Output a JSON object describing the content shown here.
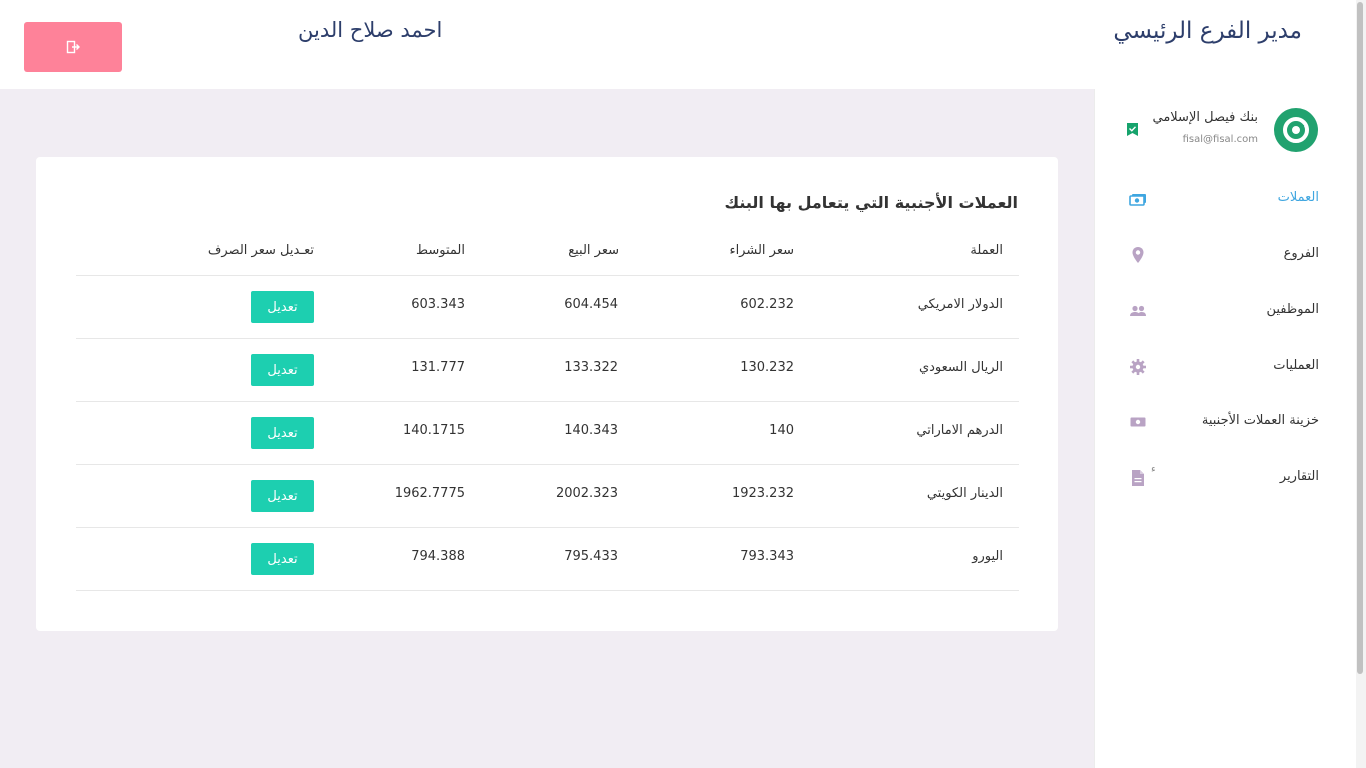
{
  "header": {
    "title": "مدير الفرع الرئيسي",
    "user_name": "احمد صلاح الدين",
    "logout_icon": "logout-icon"
  },
  "colors": {
    "logout_button": "#fe8299",
    "edit_button": "#1dcfb0",
    "active_nav": "#3fa6e0",
    "title_text": "#2d3e6b",
    "main_bg": "#f1edf3"
  },
  "sidebar": {
    "bank_name": "بنك فيصل الإسلامي",
    "bank_email": "fisal@fisal.com",
    "items": [
      {
        "label": "العملات",
        "icon": "money-icon",
        "active": true
      },
      {
        "label": "الفروع",
        "icon": "location-pin-icon",
        "active": false
      },
      {
        "label": "الموظفين",
        "icon": "people-icon",
        "active": false
      },
      {
        "label": "العمليات",
        "icon": "gear-icon",
        "active": false
      },
      {
        "label": "خزينة العملات الأجنبية",
        "icon": "money-icon",
        "active": false
      },
      {
        "label": "التقارير",
        "icon": "document-icon",
        "active": false,
        "badge": "ء"
      }
    ]
  },
  "currencies": {
    "title": "العملات الأجنبية التي يتعامل بها البنك",
    "columns": {
      "currency": "العملة",
      "buy": "سعر الشراء",
      "sell": "سعر البيع",
      "average": "المتوسط",
      "edit": "تعـديل سعر الصرف"
    },
    "edit_label": "تعديل",
    "rows": [
      {
        "currency": "الدولار الامريكي",
        "buy": "602.232",
        "sell": "604.454",
        "average": "603.343"
      },
      {
        "currency": "الريال السعودي",
        "buy": "130.232",
        "sell": "133.322",
        "average": "131.777"
      },
      {
        "currency": "الدرهم الاماراتي",
        "buy": "140",
        "sell": "140.343",
        "average": "140.1715"
      },
      {
        "currency": "الدينار الكويتي",
        "buy": "1923.232",
        "sell": "2002.323",
        "average": "1962.7775"
      },
      {
        "currency": "اليورو",
        "buy": "793.343",
        "sell": "795.433",
        "average": "794.388"
      }
    ]
  }
}
